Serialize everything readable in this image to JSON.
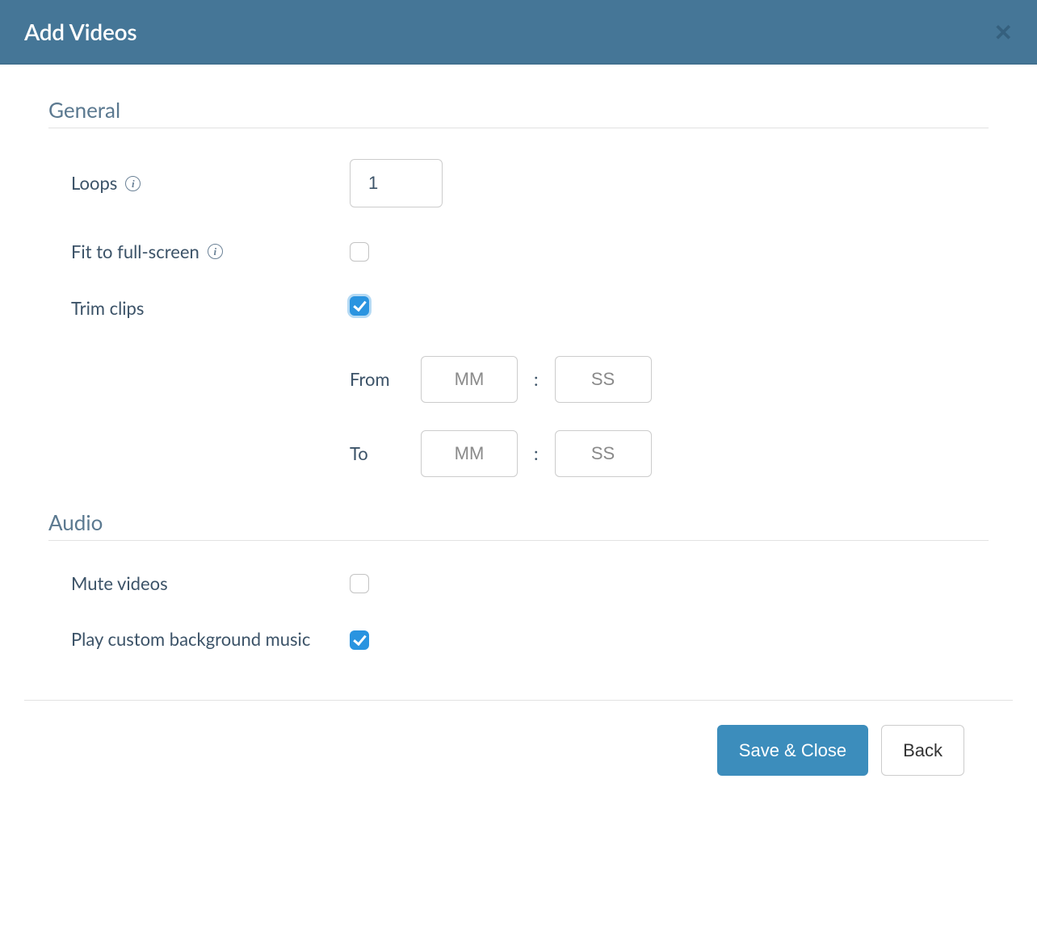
{
  "modal": {
    "title": "Add Videos"
  },
  "sections": {
    "general": {
      "title": "General",
      "loops": {
        "label": "Loops",
        "value": "1"
      },
      "fit_fullscreen": {
        "label": "Fit to full-screen",
        "checked": false
      },
      "trim_clips": {
        "label": "Trim clips",
        "checked": true
      },
      "from": {
        "label": "From",
        "mm_placeholder": "MM",
        "ss_placeholder": "SS"
      },
      "to": {
        "label": "To",
        "mm_placeholder": "MM",
        "ss_placeholder": "SS"
      },
      "colon": ":"
    },
    "audio": {
      "title": "Audio",
      "mute_videos": {
        "label": "Mute videos",
        "checked": false
      },
      "play_bg_music": {
        "label": "Play custom background music",
        "checked": true
      }
    }
  },
  "footer": {
    "save_label": "Save & Close",
    "back_label": "Back"
  }
}
